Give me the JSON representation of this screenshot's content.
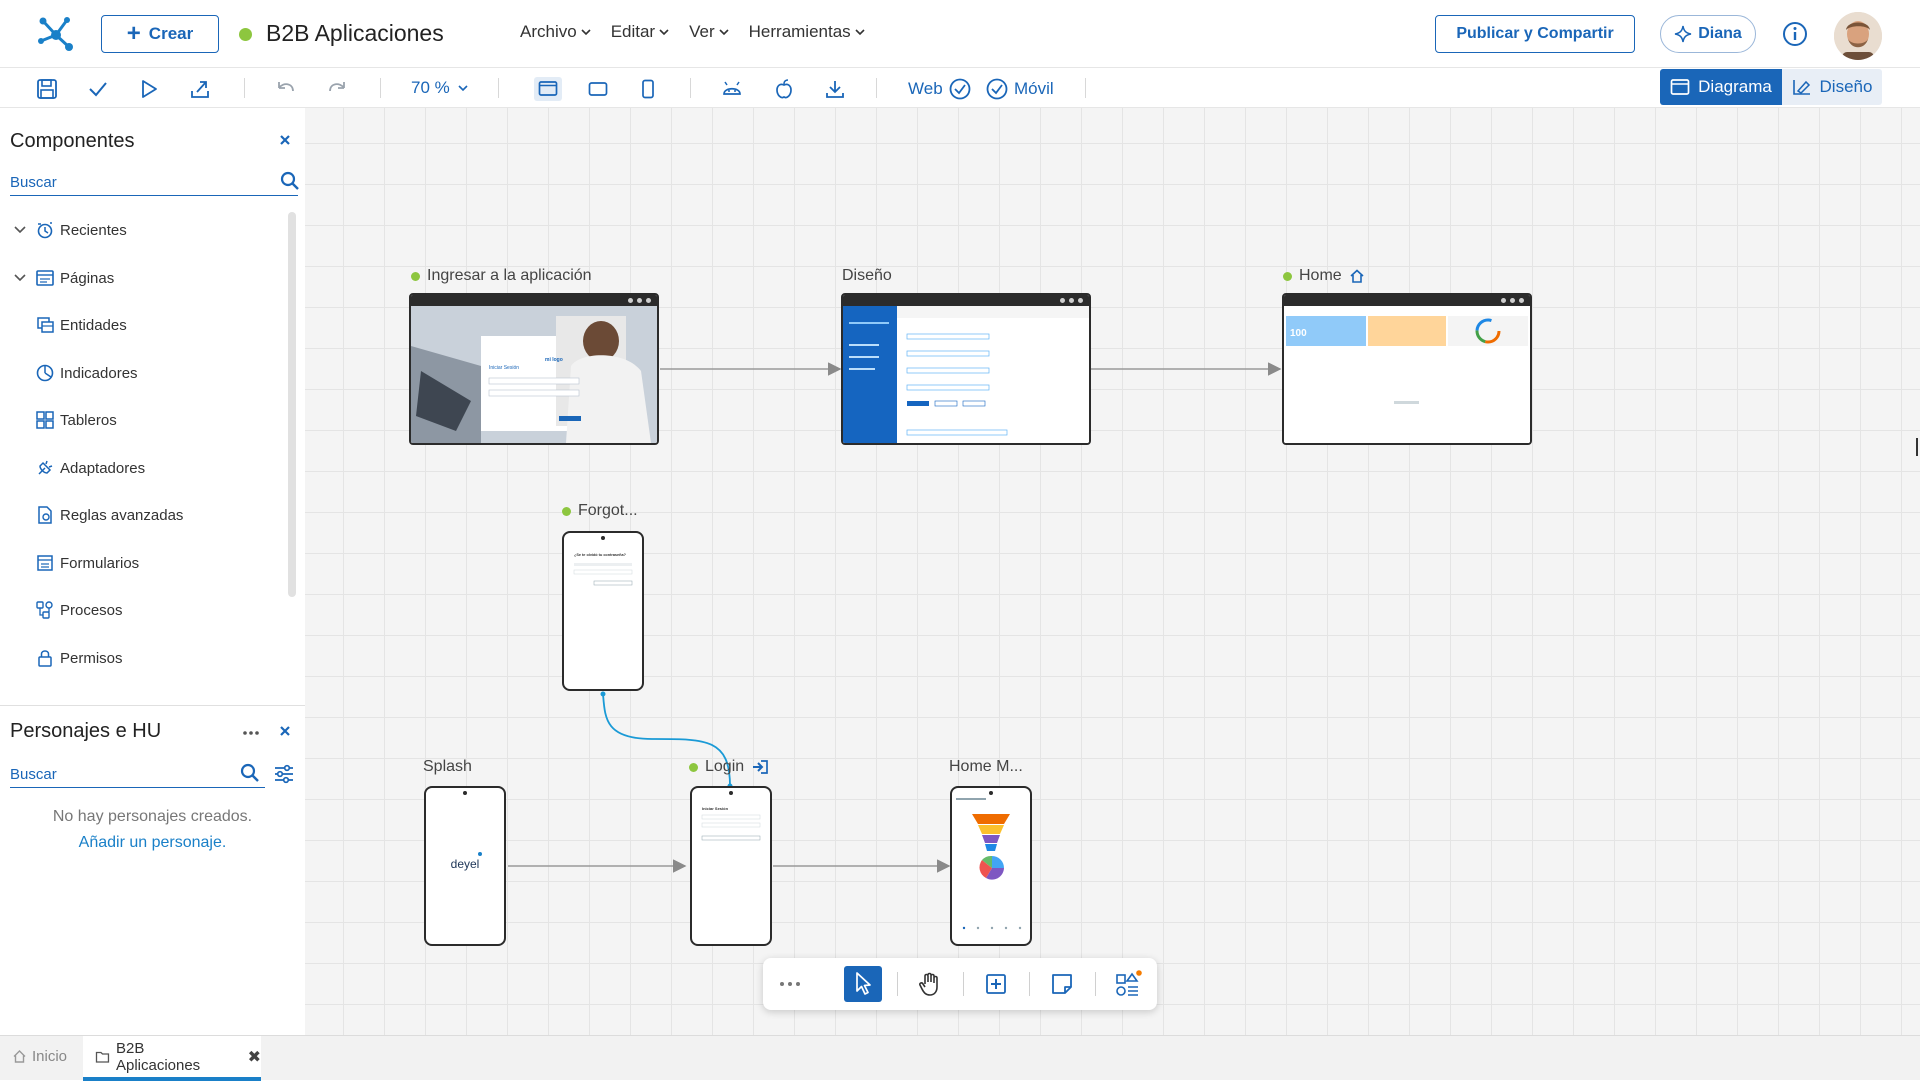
{
  "header": {
    "create_label": "Crear",
    "app_title": "B2B Aplicaciones",
    "menu": [
      "Archivo",
      "Editar",
      "Ver",
      "Herramientas"
    ],
    "publish_label": "Publicar y Compartir",
    "assistant_label": "Diana"
  },
  "toolbar": {
    "zoom": "70 %",
    "web_label": "Web",
    "mobile_label": "Móvil",
    "view_diagram": "Diagrama",
    "view_design": "Diseño"
  },
  "components_panel": {
    "title": "Componentes",
    "search_placeholder": "Buscar",
    "items": [
      {
        "label": "Recientes",
        "icon": "recent-icon"
      },
      {
        "label": "Páginas",
        "icon": "page-icon"
      },
      {
        "label": "Entidades",
        "icon": "entity-icon"
      },
      {
        "label": "Indicadores",
        "icon": "indicator-icon"
      },
      {
        "label": "Tableros",
        "icon": "dashboard-icon"
      },
      {
        "label": "Adaptadores",
        "icon": "adapter-icon"
      },
      {
        "label": "Reglas avanzadas",
        "icon": "rules-icon"
      },
      {
        "label": "Formularios",
        "icon": "form-icon"
      },
      {
        "label": "Procesos",
        "icon": "process-icon"
      },
      {
        "label": "Permisos",
        "icon": "lock-icon"
      }
    ]
  },
  "personas_panel": {
    "title": "Personajes e HU",
    "search_placeholder": "Buscar",
    "empty_text": "No hay personajes creados.",
    "add_link": "Añadir un personaje."
  },
  "diagram": {
    "nodes": [
      {
        "label": "Ingresar a la aplicación",
        "kind": "web",
        "status": "green"
      },
      {
        "label": "Diseño",
        "kind": "web"
      },
      {
        "label": "Home",
        "kind": "web",
        "status": "green",
        "home": true
      },
      {
        "label": "Forgot...",
        "kind": "mobile",
        "status": "green"
      },
      {
        "label": "Splash",
        "kind": "mobile"
      },
      {
        "label": "Login",
        "kind": "mobile",
        "status": "green",
        "login": true
      },
      {
        "label": "Home M...",
        "kind": "mobile"
      }
    ],
    "thumb_text": {
      "login_title": "Iniciar Sesión",
      "logo_text": "mi logo",
      "forgot_title": "¿Se te olvidó tu contraseña?",
      "home_kpi": "100",
      "splash_brand": "deyel"
    }
  },
  "colors": {
    "primary": "#1a66b8",
    "status_green": "#8dc63f",
    "edge_gray": "#9a9a9a",
    "edge_selected": "#1a9ad6"
  },
  "tabs": [
    {
      "label": "Inicio",
      "icon": "home-icon"
    },
    {
      "label": "B2B Aplicaciones",
      "icon": "folder-icon",
      "active": true
    }
  ]
}
